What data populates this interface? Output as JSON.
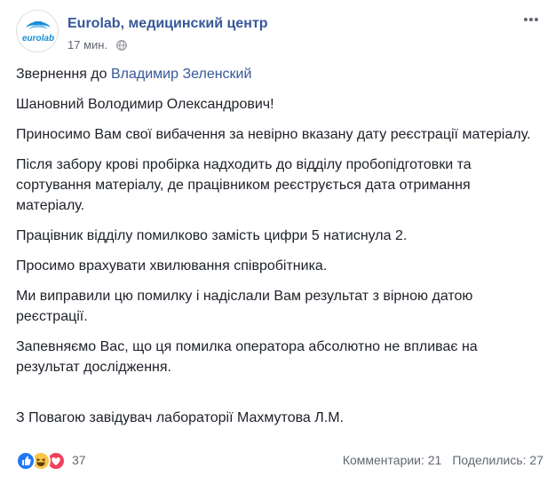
{
  "header": {
    "page_name": "Eurolab, медицинский центр",
    "timestamp": "17 мин.",
    "avatar_text": "eurolab",
    "avatar_brand_color": "#1a8fd6",
    "privacy_icon": "globe-icon",
    "menu_icon": "more-icon"
  },
  "post": {
    "addressee_prefix": "Звернення до ",
    "addressee_mention": "Владимир Зеленский",
    "paragraphs": [
      "Шановний Володимир Олександрович!",
      "Приносимо Вам свої вибачення за невірно вказану дату реєстрації матеріалу.",
      "Після забору крові пробірка надходить до відділу пробопідготовки та сортування матеріалу, де працівником реєструється дата отримання матеріалу.",
      "Працівник відділу помилково замість цифри 5 натиснула 2.",
      "Просимо врахувати хвилювання співробітника.",
      "Ми виправили цю помилку і надіслали Вам результат з вірною датою реєстрації.",
      "Запевняємо Вас, що ця помилка оператора абсолютно не впливає на результат дослідження."
    ],
    "signature": "З Повагою завідувач лабораторії Махмутова Л.М."
  },
  "footer": {
    "reaction_icons": [
      "like-icon",
      "haha-icon",
      "love-icon"
    ],
    "reaction_count": "37",
    "comments": "Комментарии: 21",
    "shares": "Поделились: 27"
  },
  "colors": {
    "link": "#365899",
    "text": "#1d2129",
    "muted": "#616770",
    "like": "#2078f4",
    "haha": "#f7c64a",
    "love": "#f2415c"
  }
}
